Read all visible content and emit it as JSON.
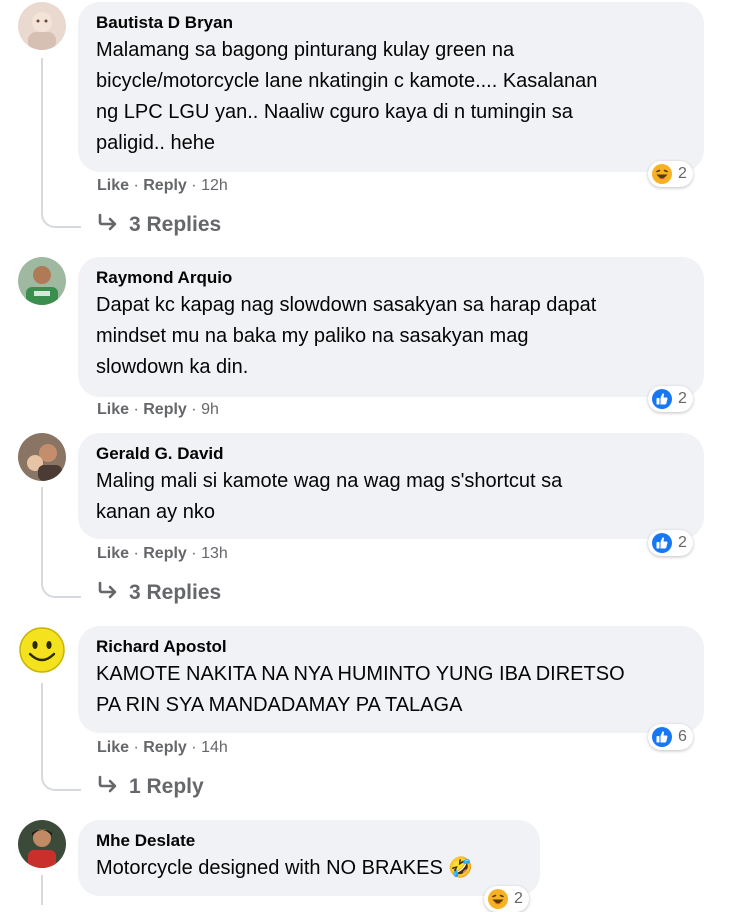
{
  "comments": [
    {
      "author": "Bautista D Bryan",
      "text": "Malamang sa bagong pinturang kulay green na\nbicycle/motorcycle lane nkatingin c kamote.... Kasalanan\nng LPC LGU yan.. Naaliw cguro kaya di n tumingin sa\npaligid.. hehe",
      "like": "Like",
      "reply": "Reply",
      "time": "12h",
      "reaction_icon": "haha-icon",
      "reaction_count": "2",
      "replies_label": "3 Replies"
    },
    {
      "author": "Raymond Arquio",
      "text": "Dapat kc kapag nag slowdown sasakyan sa harap dapat\nmindset mu na baka my paliko na sasakyan mag\nslowdown ka din.",
      "like": "Like",
      "reply": "Reply",
      "time": "9h",
      "reaction_icon": "like-icon",
      "reaction_count": "2"
    },
    {
      "author": "Gerald G. David",
      "text": "Maling mali si kamote wag na wag mag s'shortcut sa\nkanan ay nko",
      "like": "Like",
      "reply": "Reply",
      "time": "13h",
      "reaction_icon": "like-icon",
      "reaction_count": "2",
      "replies_label": "3 Replies"
    },
    {
      "author": "Richard Apostol",
      "text": "KAMOTE NAKITA NA NYA HUMINTO YUNG IBA DIRETSO\nPA RIN SYA MANDADAMAY PA TALAGA",
      "like": "Like",
      "reply": "Reply",
      "time": "14h",
      "reaction_icon": "like-icon",
      "reaction_count": "6",
      "replies_label": "1 Reply"
    },
    {
      "author": "Mhe Deslate",
      "text": "Motorcycle designed with NO BRAKES",
      "emoji": "🤣",
      "reaction_icon": "haha-icon",
      "reaction_count": "2"
    }
  ],
  "separator": "·",
  "colors": {
    "like_blue": "#1877f2",
    "haha_yellow": "#f7b125",
    "bubble_bg": "#f0f2f5",
    "meta_gray": "#65676b"
  }
}
